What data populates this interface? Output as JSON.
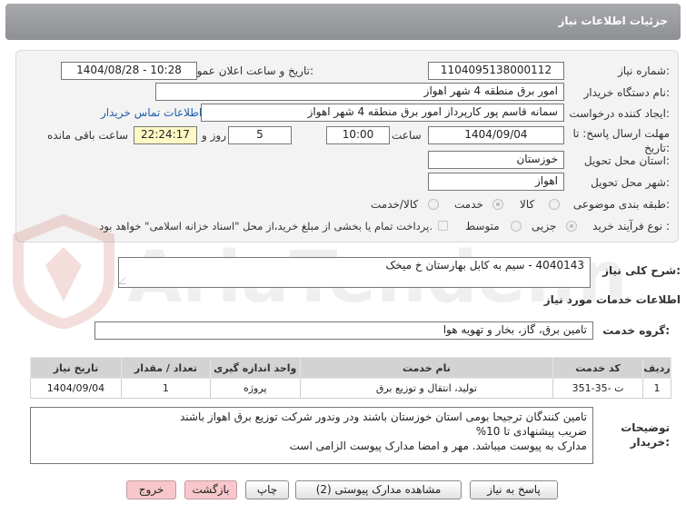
{
  "header": {
    "title": "جزئیات اطلاعات نیاز"
  },
  "fields": {
    "need_number_label": "شماره نیاز:",
    "need_number": "1104095138000112",
    "announce_label": "تاریخ و ساعت اعلان عمومی:",
    "announce_value": "1404/08/28 - 10:28",
    "buyer_org_label": "نام دستگاه خریدار:",
    "buyer_org": "امور برق منطقه 4 شهر اهواز",
    "requester_label": "ایجاد کننده درخواست:",
    "requester": "سمانه قاسم پور کارپرداز امور برق منطقه 4 شهر اهواز",
    "contact_link": "اطلاعات تماس خریدار",
    "deadline_label_1": "مهلت ارسال پاسخ: تا",
    "deadline_label_2": "تاریخ:",
    "deadline_date": "1404/09/04",
    "time_label": "ساعت",
    "deadline_time": "10:00",
    "days_value": "5",
    "days_label": "روز و",
    "remaining_time": "22:24:17",
    "remaining_label": "ساعت باقی مانده",
    "province_label": "استان محل تحویل:",
    "province": "خوزستان",
    "city_label": "شهر محل تحویل:",
    "city": "اهواز",
    "category_label": "طبقه بندی موضوعی:",
    "category_options": [
      "کالا",
      "خدمت",
      "کالا/خدمت"
    ],
    "process_label": "نوع فرآیند خرید :",
    "process_options": [
      "جزیی",
      "متوسط"
    ],
    "payment_note": "پرداخت تمام یا بخشی از مبلغ خرید،از محل \"اسناد خزانه اسلامی\" خواهد بود."
  },
  "summary": {
    "label": "شرح کلی نیاز:",
    "value": "4040143 - سیم به کابل بهارستان خ میخک"
  },
  "services_title": "اطلاعات خدمات مورد نیاز",
  "service_group": {
    "label": "گروه خدمت:",
    "value": "تامین برق، گاز، بخار و تهویه هوا"
  },
  "table": {
    "headers": [
      "ردیف",
      "کد خدمت",
      "نام خدمت",
      "واحد اندازه گیری",
      "تعداد / مقدار",
      "تاریخ نیاز"
    ],
    "rows": [
      [
        "1",
        "ت -35-351",
        "تولید، انتقال و توزیع برق",
        "پروژه",
        "1",
        "1404/09/04"
      ]
    ]
  },
  "buyer_notes": {
    "label_1": "توضیحات",
    "label_2": "خریدار:",
    "lines": [
      "تامین کنندگان ترجیحا بومی استان خوزستان باشند ودر وندور شرکت توزیع برق اهواز باشند",
      "ضریب پیشنهادی تا 10%",
      "مدارک به پیوست میباشد. مهر و امضا مدارک پیوست الزامی است"
    ]
  },
  "buttons": {
    "reply": "پاسخ به نیاز",
    "attachments": "مشاهده مدارک پیوستی (2)",
    "print": "چاپ",
    "back": "بازگشت",
    "exit": "خروج"
  },
  "watermark_text": "AriaTender.net",
  "colors": {
    "header_bg": "#9b9da0",
    "link": "#1f5fa8",
    "remaining_bg": "#fff9c4",
    "pink_button": "#f7c7cb"
  }
}
